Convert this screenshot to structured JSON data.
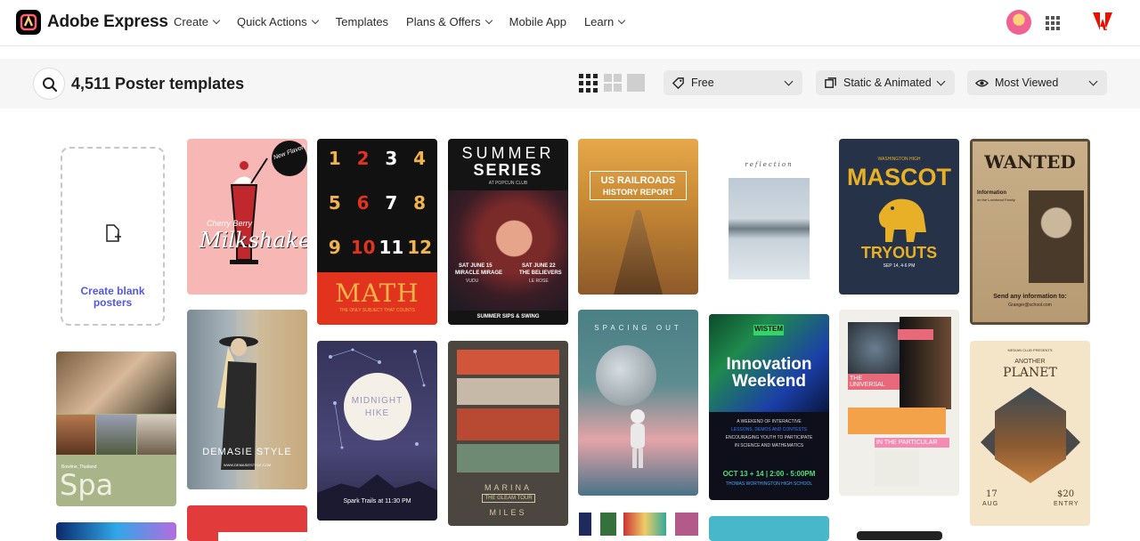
{
  "brand": {
    "name": "Adobe Express"
  },
  "nav": [
    {
      "label": "Create",
      "dropdown": true
    },
    {
      "label": "Quick Actions",
      "dropdown": true
    },
    {
      "label": "Templates",
      "dropdown": false
    },
    {
      "label": "Plans & Offers",
      "dropdown": true
    },
    {
      "label": "Mobile App",
      "dropdown": false
    },
    {
      "label": "Learn",
      "dropdown": true
    }
  ],
  "toolbar": {
    "count_label": "4,511 Poster templates",
    "filters": [
      {
        "label": "Free",
        "icon": "price-tag-icon"
      },
      {
        "label": "Static & Animated",
        "icon": "animation-icon"
      },
      {
        "label": "Most Viewed",
        "icon": "eye-icon"
      }
    ]
  },
  "blank": {
    "label": "Create blank posters"
  },
  "templates": {
    "milkshake": {
      "badge": "New Flavor!",
      "script1": "Cherry Berry",
      "script2": "Milkshake"
    },
    "math": {
      "digits": [
        "1",
        "2",
        "3",
        "4",
        "5",
        "6",
        "7",
        "8",
        "9",
        "10",
        "11",
        "12"
      ],
      "title": "MATH",
      "subtitle": "THE ONLY SUBJECT THAT COUNTS"
    },
    "summer": {
      "title1": "SUMMER",
      "title2": "SERIES",
      "sub": "AT POPCUN CLUB",
      "left1": "SAT JUNE 15",
      "left2": "MIRACLE MIRAGE",
      "left3": "VUDU",
      "right1": "SAT JUNE 22",
      "right2": "THE BELIEVERS",
      "right3": "LE ROSE",
      "footer": "SUMMER SIPS & SWING"
    },
    "railroads": {
      "title1": "US RAILROADS",
      "title2": "HISTORY REPORT"
    },
    "reflection": {
      "title": "reflection"
    },
    "mascot": {
      "top": "WASHINGTON HIGH",
      "title": "MASCOT",
      "sub": "TRYOUTS",
      "date": "SEP 14, 4-6 PM"
    },
    "wanted": {
      "title": "WANTED",
      "info": "Information",
      "sub": "on the Lochhead Family",
      "send": "Send any information to:",
      "email": "Granger@school.com"
    },
    "spa": {
      "title": "Spa",
      "sub": "Bowline, Thailand"
    },
    "demasie": {
      "title": "DEMASIE STYLE",
      "url": "WWW.DEMASIESTYLE.COM"
    },
    "midnight": {
      "title1": "MIDNIGHT",
      "title2": "HIKE",
      "footer": "Spark Trails at 11:30 PM"
    },
    "marina": {
      "title1": "MARINA",
      "tour": "THE GLEAM TOUR",
      "title2": "MILES"
    },
    "spacing": {
      "title": "SPACING OUT"
    },
    "innovation": {
      "tag": "WISTEM",
      "title1": "Innovation",
      "title2": "Weekend",
      "body1": "A WEEKEND OF INTERACTIVE",
      "body2": "LESSONS, DEMOS AND CONTESTS",
      "body3": "ENCOURAGING YOUTH TO PARTICIPATE",
      "body4": "IN SCIENCE AND MATHEMATICS",
      "date": "OCT 13 + 14 | 2:00 - 5:00PM",
      "school": "THOMAS WORTHINGTON HIGH SCHOOL"
    },
    "universal": {
      "t1": "THE UNIVERSAL",
      "t2": "IN THE PARTICULAR"
    },
    "planet": {
      "top": "MEDIAN CLUB PRESENTS",
      "t1": "ANOTHER",
      "t2": "PLANET",
      "d1": "17",
      "d2": "AUG",
      "p1": "$20",
      "p2": "ENTRY"
    }
  }
}
